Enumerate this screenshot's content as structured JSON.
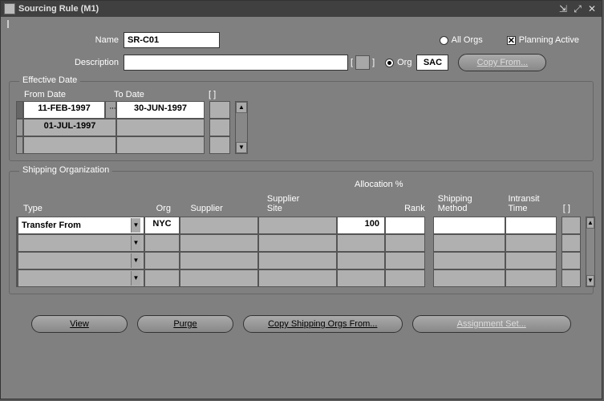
{
  "window": {
    "title": "Sourcing Rule (M1)"
  },
  "header": {
    "name_label": "Name",
    "name_value": "SR-C01",
    "desc_label": "Description",
    "desc_value": "",
    "all_orgs_label": "All Orgs",
    "org_label": "Org",
    "org_value": "SAC",
    "planning_active_label": "Planning Active",
    "copy_from_label": "Copy From..."
  },
  "effective": {
    "legend": "Effective Date",
    "from_label": "From Date",
    "to_label": "To Date",
    "bracket_label": "[   ]",
    "rows": [
      {
        "from": "11-FEB-1997",
        "to": "30-JUN-1997",
        "active": true
      },
      {
        "from": "01-JUL-1997",
        "to": "",
        "active": false
      },
      {
        "from": "",
        "to": "",
        "active": false
      }
    ]
  },
  "shipping": {
    "legend": "Shipping Organization",
    "alloc_group": "Allocation %",
    "cols": {
      "type": "Type",
      "org": "Org",
      "supplier": "Supplier",
      "site": "Supplier\nSite",
      "rank": "Rank",
      "method": "Shipping\nMethod",
      "intransit": "Intransit\nTime",
      "bracket": "[   ]"
    },
    "rows": [
      {
        "type": "Transfer From",
        "org": "NYC",
        "supplier": "",
        "site": "",
        "alloc": "100",
        "rank": "",
        "method": "",
        "intransit": "",
        "active": true
      },
      {
        "type": "",
        "org": "",
        "supplier": "",
        "site": "",
        "alloc": "",
        "rank": "",
        "method": "",
        "intransit": "",
        "active": false
      },
      {
        "type": "",
        "org": "",
        "supplier": "",
        "site": "",
        "alloc": "",
        "rank": "",
        "method": "",
        "intransit": "",
        "active": false
      },
      {
        "type": "",
        "org": "",
        "supplier": "",
        "site": "",
        "alloc": "",
        "rank": "",
        "method": "",
        "intransit": "",
        "active": false
      }
    ]
  },
  "buttons": {
    "view": "View",
    "purge": "Purge",
    "copy_ship": "Copy Shipping Orgs From...",
    "assign": "Assignment Set..."
  }
}
